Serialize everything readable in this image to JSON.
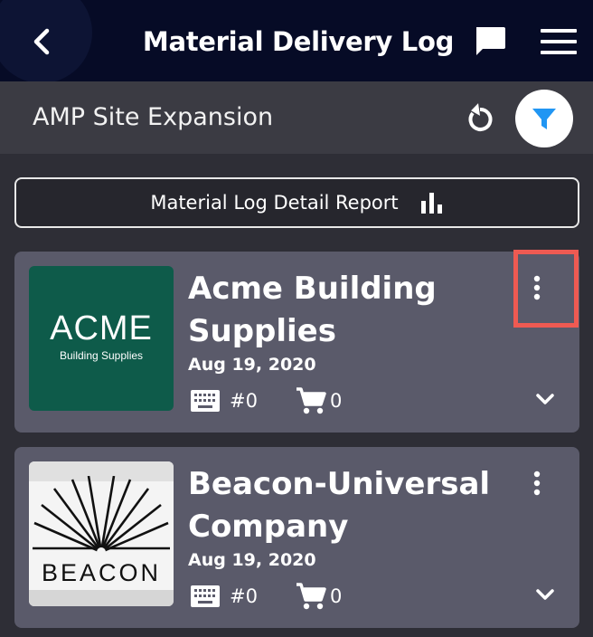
{
  "header": {
    "title": "Material Delivery Log",
    "icons": [
      "back-arrow-icon",
      "chat-icon",
      "hamburger-menu-icon"
    ]
  },
  "subheader": {
    "project_name": "AMP Site Expansion",
    "icons": [
      "refresh-icon",
      "filter-icon"
    ],
    "filter_color": "#2196f3"
  },
  "report_button": {
    "label": "Material Log Detail Report",
    "icon": "bar-chart-icon"
  },
  "deliveries": [
    {
      "vendor": "Acme Building Supplies",
      "logo": {
        "main": "ACME",
        "sub": "Building Supplies",
        "bg": "#0e5b4a"
      },
      "date": "Aug 19, 2020",
      "ticket_number": "#0",
      "item_count": "0"
    },
    {
      "vendor": "Beacon-Universal Company",
      "logo": {
        "main": "BEACON"
      },
      "date": "Aug 19, 2020",
      "ticket_number": "#0",
      "item_count": "0"
    }
  ],
  "colors": {
    "topbar": "#060b26",
    "subheader": "#3b3b43",
    "card": "#5a5a6a",
    "highlight": "#ef5a52"
  }
}
